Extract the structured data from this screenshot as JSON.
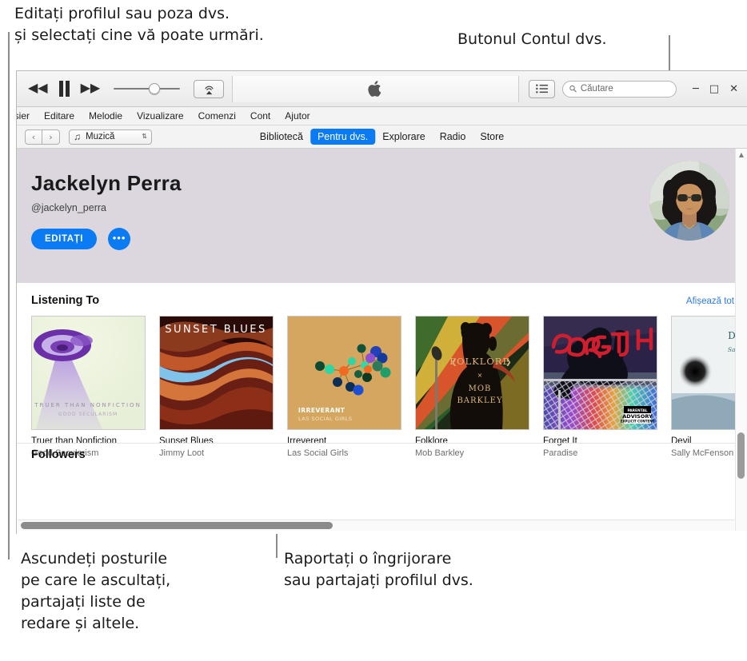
{
  "callouts": {
    "top_left": "Editați profilul sau poza dvs.\nși selectați cine vă poate urmări.",
    "top_right": "Butonul Contul dvs.",
    "bottom_left": "Ascundeți posturile\npe care le ascultați,\npartajați liste de\nredare și altele.",
    "bottom_center": "Raportați o îngrijorare\nsau partajați profilul dvs."
  },
  "window": {
    "minimize_glyph": "─",
    "maximize_glyph": "□",
    "close_glyph": "✕"
  },
  "transport": {
    "rewind_glyph": "◀◀",
    "pause_label": "pause",
    "fastforward_glyph": "▶▶",
    "volume_value": 53,
    "airplay_label": "AirPlay"
  },
  "search": {
    "placeholder": "Căutare",
    "value": ""
  },
  "menubar": {
    "items": [
      "isier",
      "Editare",
      "Melodie",
      "Vizualizare",
      "Comenzi",
      "Cont",
      "Ajutor"
    ]
  },
  "navbar": {
    "back_glyph": "‹",
    "forward_glyph": "›",
    "library_select": "Muzică",
    "note_glyph": "♫",
    "chevron_glyph": "⇅",
    "tabs": [
      {
        "label": "Bibliotecă",
        "active": false
      },
      {
        "label": "Pentru dvs.",
        "active": true
      },
      {
        "label": "Explorare",
        "active": false
      },
      {
        "label": "Radio",
        "active": false
      },
      {
        "label": "Store",
        "active": false
      }
    ]
  },
  "profile": {
    "name": "Jackelyn  Perra",
    "handle": "@jackelyn_perra",
    "edit_button": "EDITAȚI",
    "more_button": "•••",
    "avatar_name": "user-avatar"
  },
  "listening": {
    "title": "Listening To",
    "show_all": "Afișează tot",
    "albums": [
      {
        "title": "Truer than Nonfiction",
        "artist": "Good Secularism",
        "cover_text": "TRUER THAN NONFICTION",
        "cover_sub": "GOOD SECULARISM",
        "explicit": false
      },
      {
        "title": "Sunset Blues",
        "artist": "Jimmy Loot",
        "cover_text": "SUNSET BLUES",
        "cover_sub": "",
        "explicit": false
      },
      {
        "title": "Irreverent",
        "artist": "Las Social Girls",
        "cover_text": "IRREVERANT",
        "cover_sub": "LAS SOCIAL GIRLS",
        "explicit": false
      },
      {
        "title": "Folklore",
        "artist": "Mob Barkley",
        "cover_text": "FOLKLORE",
        "cover_sub": "MOB BARKLEY",
        "explicit": false
      },
      {
        "title": "Forget It",
        "artist": "Paradise",
        "cover_text": "FORGET IT",
        "cover_sub": "",
        "explicit": true
      },
      {
        "title": "Devil",
        "artist": "Sally McFenson",
        "cover_text": "DEVIL",
        "cover_sub": "Sally McFenson",
        "explicit": false
      }
    ]
  },
  "followers": {
    "title": "Followers"
  },
  "colors": {
    "accent": "#0a7bf3",
    "link": "#2f7ae5",
    "header_bg": "#dcd7de"
  }
}
